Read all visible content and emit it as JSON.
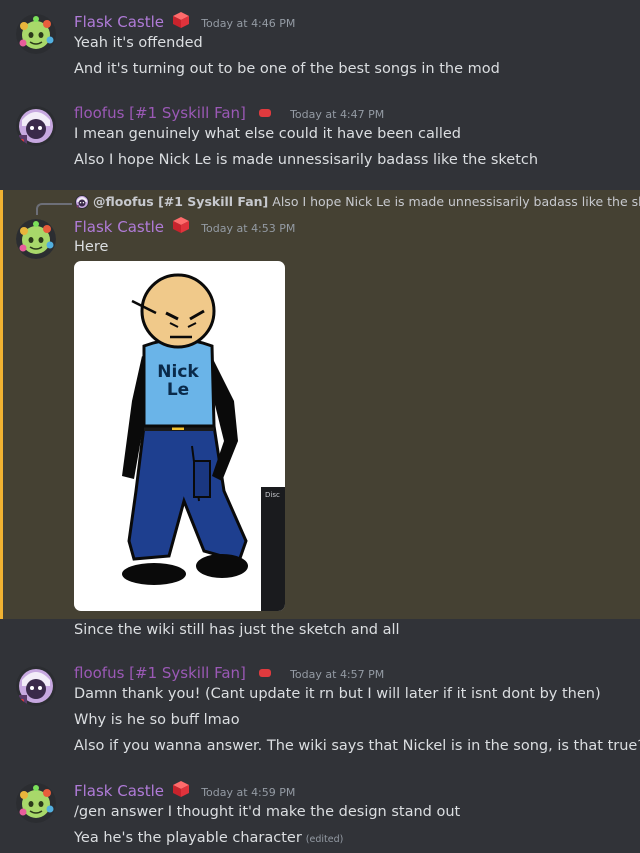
{
  "colors": {
    "background": "#313338",
    "highlight": "#454133",
    "highlight_bar": "#f0b232",
    "username_flask": "#b07bd8",
    "username_floofus": "#9b59b6"
  },
  "messages": [
    {
      "username": "Flask Castle",
      "timestamp": "Today at 4:46 PM",
      "lines": [
        "Yeah it's offended",
        "And it's turning out to be one of the best songs in the mod"
      ]
    },
    {
      "username": "floofus [#1 Syskill Fan]",
      "timestamp": "Today at 4:47 PM",
      "lines": [
        "I mean genuinely what else could it have been called",
        "Also I hope Nick Le is made unnessisarily badass like the sketch"
      ]
    },
    {
      "reply": {
        "mention": "@floofus [#1 Syskill Fan]",
        "text": "Also I hope Nick Le is made unnessisarily badass like the sketch"
      },
      "username": "Flask Castle",
      "timestamp": "Today at 4:53 PM",
      "lines": [
        "Here",
        "Since the wiki still has just the sketch and all"
      ],
      "image": {
        "shirt_text_1": "Nick",
        "shirt_text_2": "Le",
        "overlay_text": "Disc"
      }
    },
    {
      "username": "floofus [#1 Syskill Fan]",
      "timestamp": "Today at 4:57 PM",
      "lines": [
        "Damn thank you! (Cant update it rn but I will later if it isnt dont by then)",
        "Why is he so buff lmao",
        "Also if you wanna answer. The wiki says that Nickel is in the song, is that true?"
      ]
    },
    {
      "username": "Flask Castle",
      "timestamp": "Today at 4:59 PM",
      "lines": [
        "/gen answer I thought it'd make the design stand out",
        "Yea he's the playable character"
      ],
      "edited": "(edited)"
    }
  ]
}
